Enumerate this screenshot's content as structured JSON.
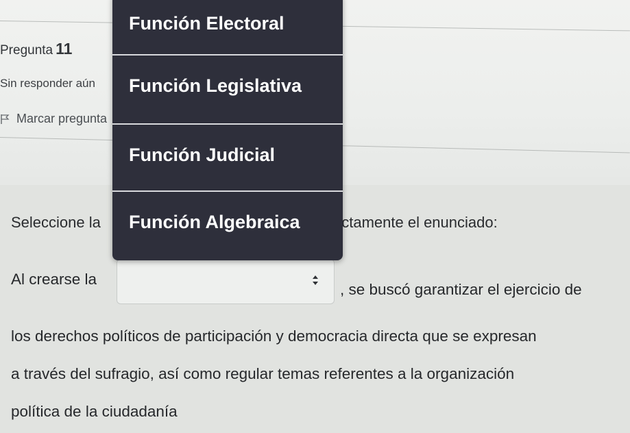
{
  "question": {
    "label": "Pregunta",
    "number": "11",
    "status": "Sin responder aún",
    "flag_label": "Marcar pregunta",
    "flag_icon": "flag-icon"
  },
  "instruction": {
    "left": "Seleccione la",
    "right": "ectamente el enunciado:"
  },
  "body": {
    "line1_start": "Al crearse la",
    "line1_end": ", se buscó garantizar el ejercicio de",
    "line2": "los derechos políticos de participación y democracia directa que se expresan",
    "line3": "a través del sufragio, así como regular temas referentes a la organización",
    "line4": "política de la ciudadanía"
  },
  "select": {
    "selected_value": "",
    "arrow_icon": "updown-arrows-icon"
  },
  "dropdown": {
    "options": [
      "Función Electoral",
      "Función Legislativa",
      "Función Judicial",
      "Función Algebraica"
    ]
  },
  "colors": {
    "dropdown_bg": "#2e2f3b",
    "dropdown_text": "#ffffff",
    "page_bg": "#e1e3e0"
  }
}
